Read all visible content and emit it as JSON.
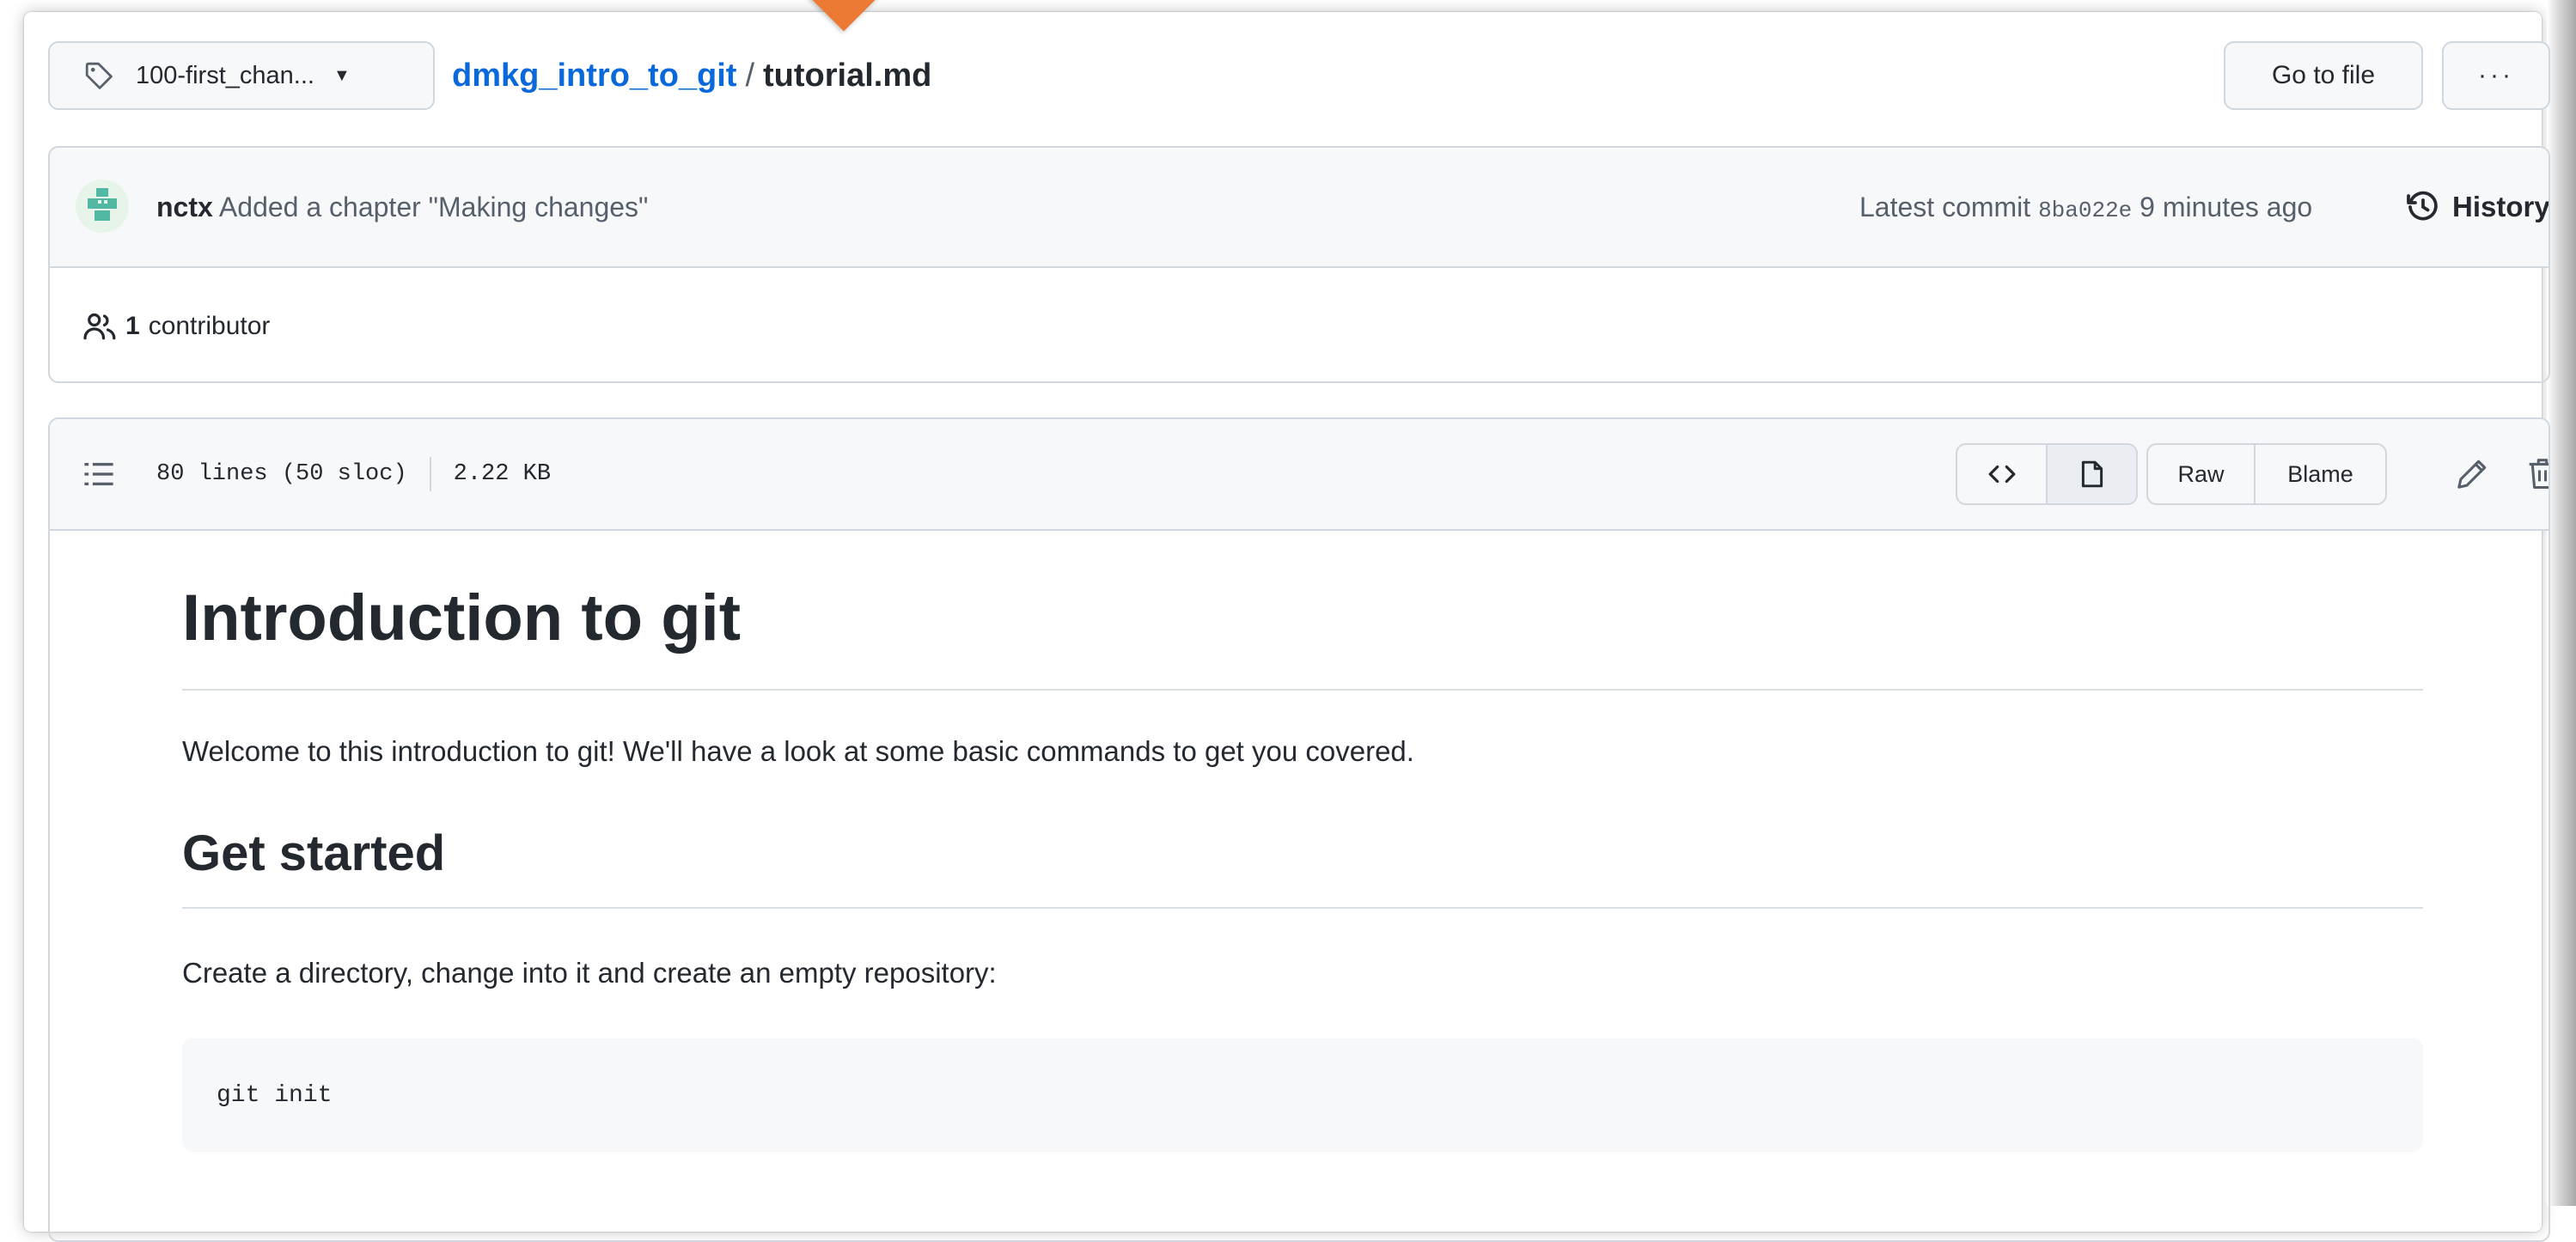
{
  "top_bar": {
    "branch_label": "100-first_chan...",
    "breadcrumb": {
      "repo": "dmkg_intro_to_git",
      "separator": "/",
      "file": "tutorial.md"
    },
    "go_to_file_label": "Go to file",
    "more_label": "···"
  },
  "commit": {
    "author": "nctx",
    "message": "Added a chapter \"Making changes\"",
    "latest_label": "Latest commit",
    "sha": "8ba022e",
    "time": "9 minutes ago",
    "history_label": "History"
  },
  "contributors": {
    "count": "1",
    "label": "contributor"
  },
  "file": {
    "lines": "80 lines (50 sloc)",
    "size": "2.22 KB",
    "raw_label": "Raw",
    "blame_label": "Blame"
  },
  "markdown": {
    "h1": "Introduction to git",
    "intro": "Welcome to this introduction to git! We'll have a look at some basic commands to get you covered.",
    "h2": "Get started",
    "step": "Create a directory, change into it and create an empty repository:",
    "code": "git init"
  },
  "colors": {
    "link": "#0969da",
    "border": "#d0d7de",
    "header_bg": "#f6f8fa",
    "marker": "#ec7a34"
  }
}
